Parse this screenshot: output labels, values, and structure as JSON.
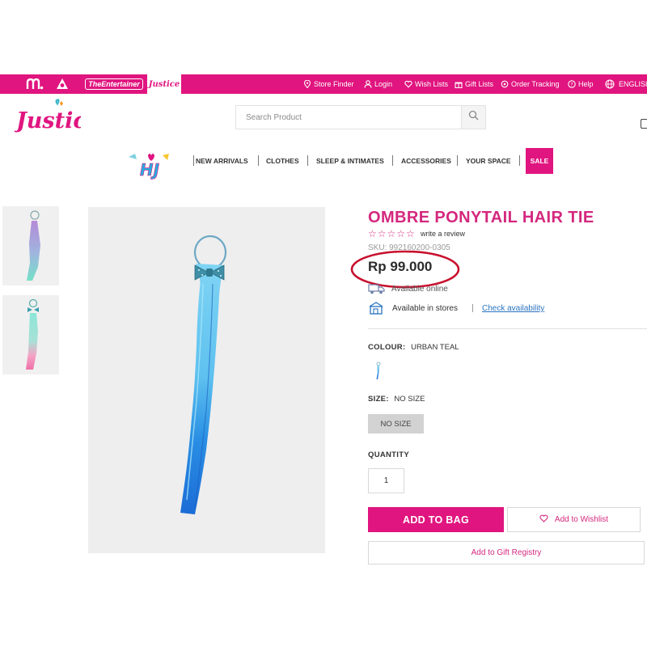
{
  "topbar": {
    "brands": {
      "entertainer": "TheEntertainer",
      "justice": "Justice"
    },
    "links": [
      {
        "label": "Store Finder",
        "icon": "location-pin-icon"
      },
      {
        "label": "Login",
        "icon": "user-icon"
      },
      {
        "label": "Wish Lists",
        "icon": "heart-icon"
      },
      {
        "label": "Gift Lists",
        "icon": "gift-icon"
      },
      {
        "label": "Order Tracking",
        "icon": "truck-icon"
      },
      {
        "label": "Help",
        "icon": "help-circle-icon"
      },
      {
        "label": "ENGLISH",
        "icon": "globe-icon"
      }
    ]
  },
  "header": {
    "logo_text": "Justice",
    "search_placeholder": "Search Product"
  },
  "nav": {
    "logo_text": "HJ",
    "items": [
      "NEW ARRIVALS",
      "CLOTHES",
      "SLEEP & INTIMATES",
      "ACCESSORIES",
      "YOUR SPACE"
    ],
    "sale": "SALE"
  },
  "product": {
    "title": "OMBRE PONYTAIL HAIR TIE",
    "stars": "☆☆☆☆☆",
    "review_link": "write a review",
    "sku": "SKU: 992160200-0305",
    "price": "Rp 99.000",
    "available_online": "Available online",
    "available_stores": "Available in stores",
    "check_availability": "Check availability",
    "colour_label": "COLOUR:",
    "colour_value": "URBAN TEAL",
    "size_label": "SIZE:",
    "size_value": "NO SIZE",
    "size_option": "NO SIZE",
    "quantity_label": "QUANTITY",
    "quantity_value": "1",
    "add_to_bag": "ADD TO BAG",
    "add_to_wishlist": "Add to Wishlist",
    "add_to_gift_registry": "Add to Gift Registry"
  },
  "colors": {
    "brand_pink": "#e0157f",
    "title_pink": "#d4287e",
    "link_blue": "#2a74c0",
    "annotation_red": "#c8102e"
  }
}
